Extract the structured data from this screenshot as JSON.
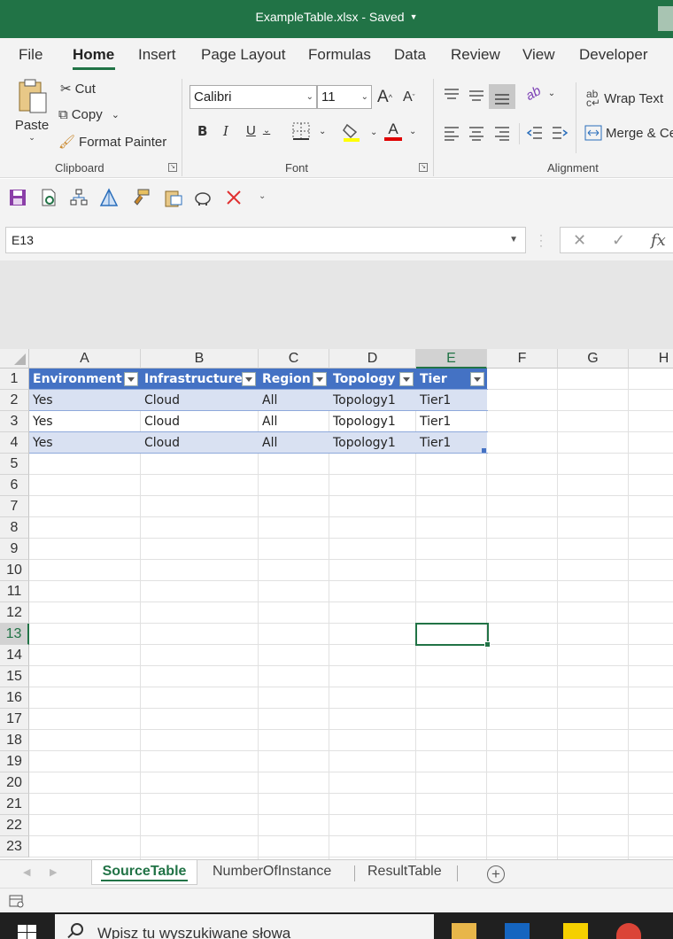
{
  "window": {
    "title": "ExampleTable.xlsx - Saved"
  },
  "tabs": [
    "File",
    "Home",
    "Insert",
    "Page Layout",
    "Formulas",
    "Data",
    "Review",
    "View",
    "Developer"
  ],
  "active_tab": "Home",
  "ribbon": {
    "clipboard": {
      "paste": "Paste",
      "cut": "Cut",
      "copy": "Copy",
      "format_painter": "Format Painter",
      "label": "Clipboard"
    },
    "font": {
      "name": "Calibri",
      "size": "11",
      "bold": "B",
      "italic": "I",
      "underline": "U",
      "label": "Font",
      "grow": "A",
      "shrink": "A",
      "font_color": "A"
    },
    "alignment": {
      "wrap_text": "Wrap Text",
      "merge": "Merge & Ce",
      "label": "Alignment"
    }
  },
  "formula_bar": {
    "name_box": "E13",
    "fx": "fx"
  },
  "columns": [
    "A",
    "B",
    "C",
    "D",
    "E",
    "F",
    "G",
    "H"
  ],
  "rows": [
    "1",
    "2",
    "3",
    "4",
    "5",
    "6",
    "7",
    "8",
    "9",
    "10",
    "11",
    "12",
    "13",
    "14",
    "15",
    "16",
    "17",
    "18",
    "19",
    "20",
    "21",
    "22",
    "23"
  ],
  "table": {
    "headers": [
      "Environment",
      "Infrastructure",
      "Region",
      "Topology",
      "Tier"
    ],
    "rows": [
      [
        "Yes",
        "Cloud",
        "All",
        "Topology1",
        "Tier1"
      ],
      [
        "Yes",
        "Cloud",
        "All",
        "Topology1",
        "Tier1"
      ],
      [
        "Yes",
        "Cloud",
        "All",
        "Topology1",
        "Tier1"
      ]
    ]
  },
  "selected_cell": "E13",
  "sheets": [
    "SourceTable",
    "NumberOfInstance",
    "ResultTable"
  ],
  "active_sheet": "SourceTable",
  "taskbar": {
    "search_placeholder": "Wpisz tu wyszukiwane słowa"
  },
  "colors": {
    "excel_green": "#217346",
    "table_header": "#4472c4",
    "table_band": "#d9e1f2"
  }
}
